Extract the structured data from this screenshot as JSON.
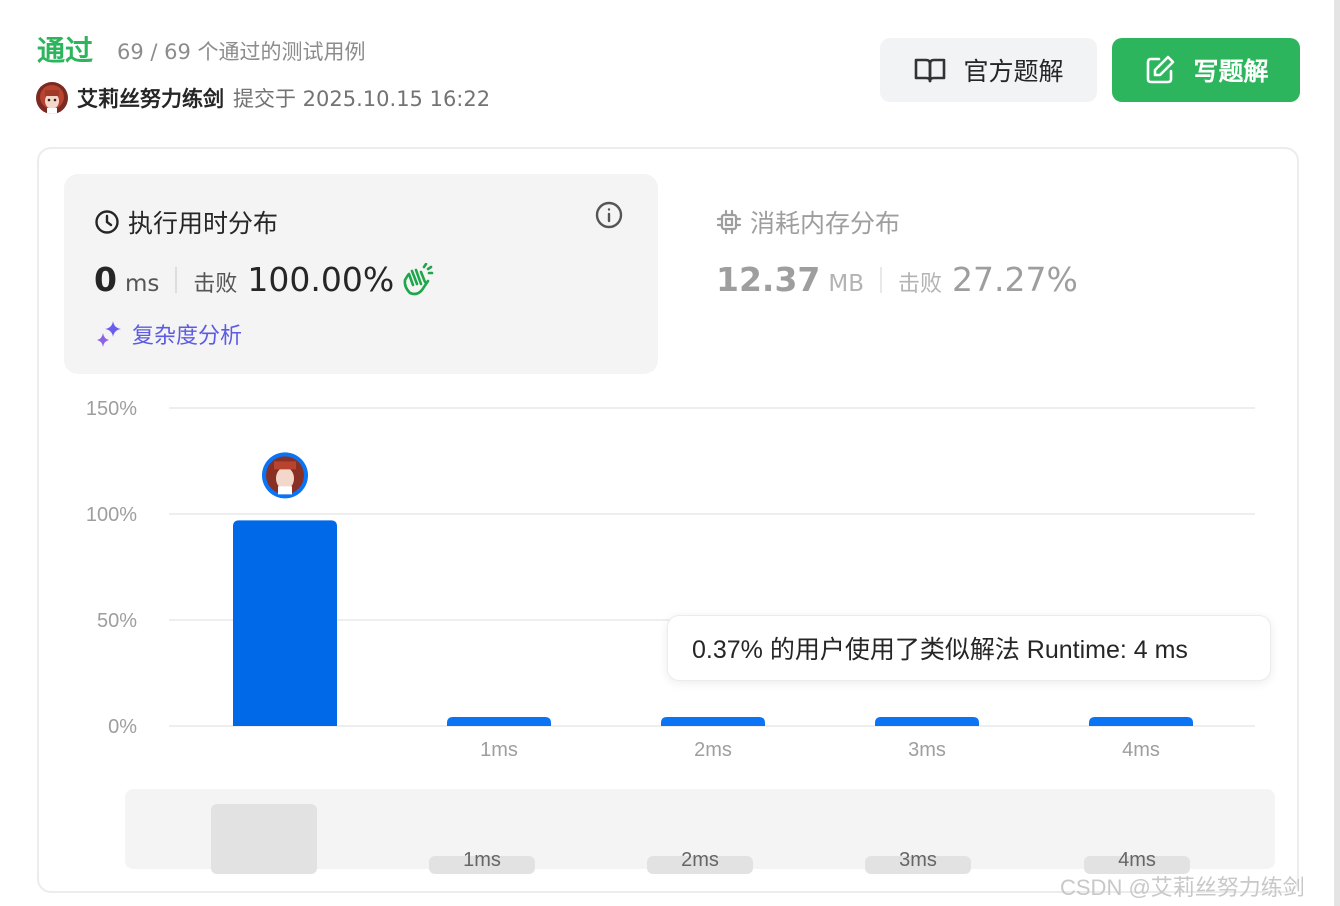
{
  "header": {
    "status": "通过",
    "testcases": "69 / 69 个通过的测试用例",
    "submitter": "艾莉丝努力练剑",
    "submit_time": "提交于 2025.10.15 16:22"
  },
  "buttons": {
    "official_solution": "官方题解",
    "write_solution": "写题解"
  },
  "runtime": {
    "title": "执行用时分布",
    "value": "0",
    "unit": "ms",
    "beat_label": "击败",
    "beat_value": "100.00%",
    "analysis": "复杂度分析"
  },
  "memory": {
    "title": "消耗内存分布",
    "value": "12.37",
    "unit": "MB",
    "beat_label": "击败",
    "beat_value": "27.27%"
  },
  "tooltip": "0.37% 的用户使用了类似解法 Runtime: 4 ms",
  "watermark": "CSDN @艾莉丝努力练剑",
  "colors": {
    "accent_green": "#2db55d",
    "bar_blue": "#0069e8",
    "analysis_purple": "#5b5ce2"
  },
  "chart_data": {
    "type": "bar",
    "categories": [
      "",
      "1ms",
      "2ms",
      "3ms",
      "4ms"
    ],
    "values": [
      97,
      0.37,
      0.37,
      0.37,
      0.37
    ],
    "yticks": [
      "150%",
      "100%",
      "50%",
      "0%"
    ],
    "ylim": [
      0,
      150
    ],
    "highlight_index": 0,
    "grid": true,
    "overview_labels": [
      "1ms",
      "2ms",
      "3ms",
      "4ms"
    ]
  }
}
